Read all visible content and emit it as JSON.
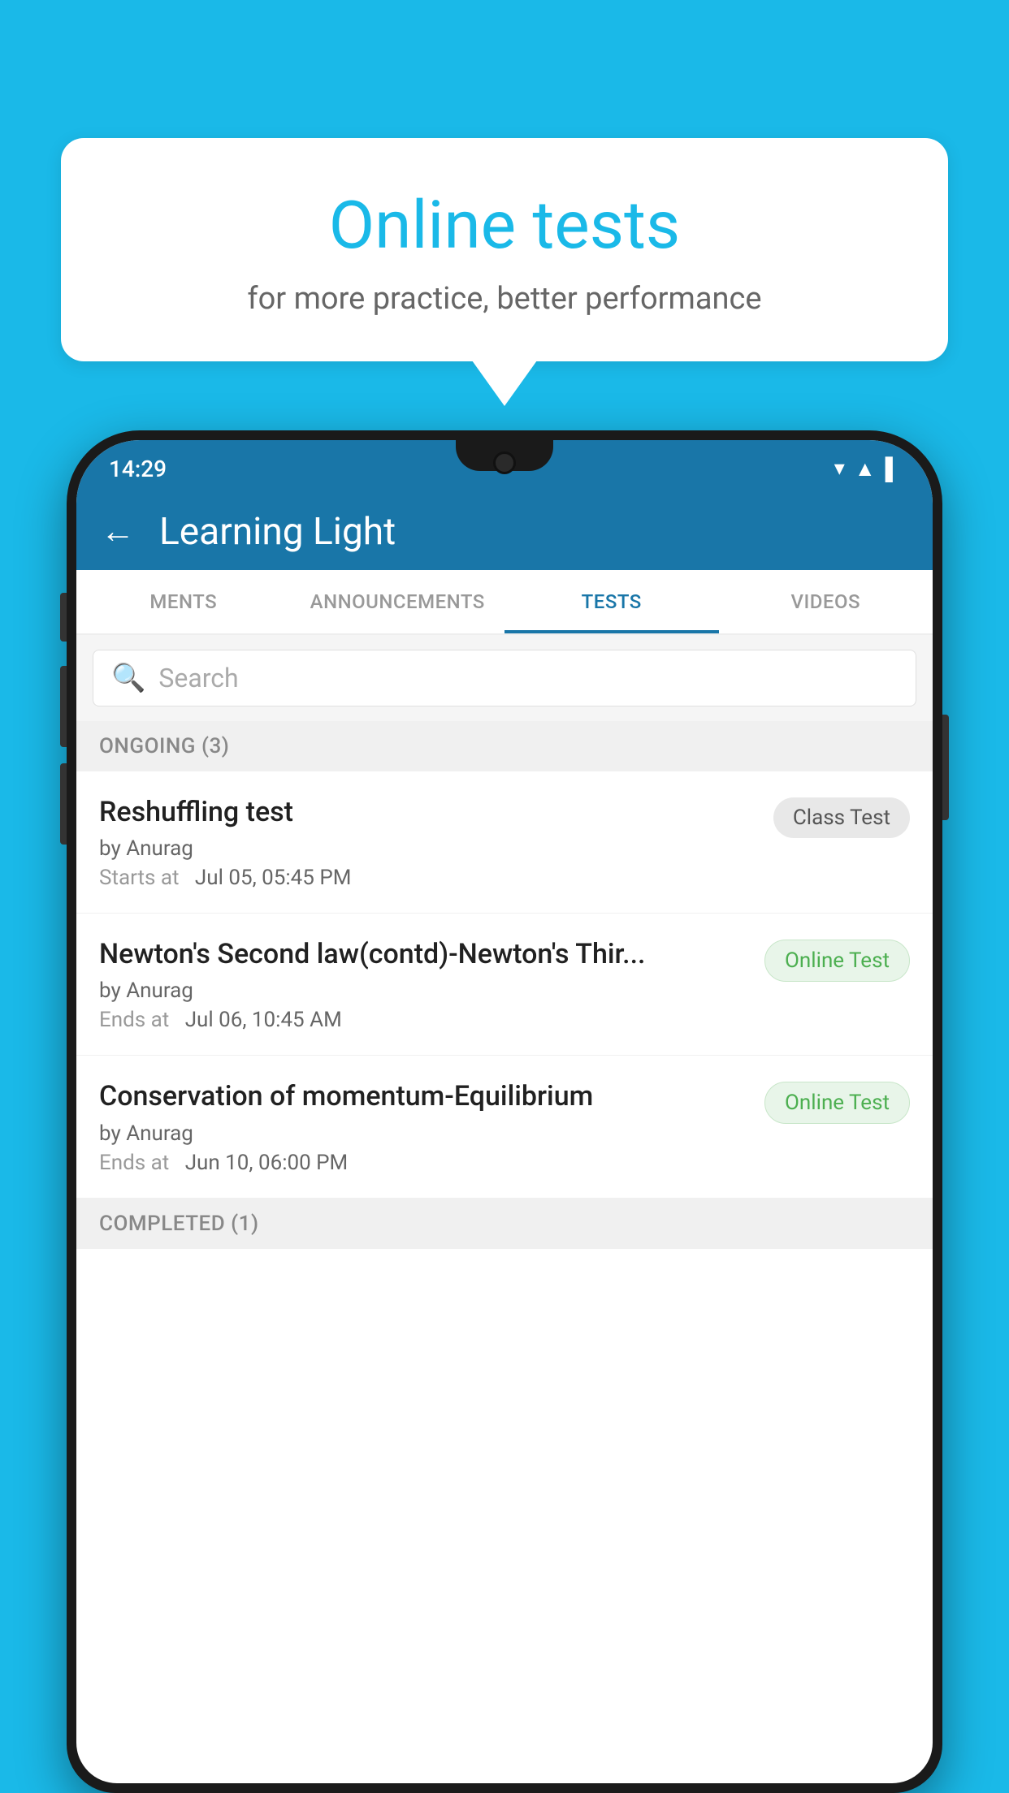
{
  "background_color": "#1ab9e8",
  "speech_bubble": {
    "title": "Online tests",
    "subtitle": "for more practice, better performance"
  },
  "app": {
    "name": "Learning Light",
    "back_label": "←"
  },
  "status_bar": {
    "time": "14:29"
  },
  "tabs": [
    {
      "label": "MENTS",
      "active": false
    },
    {
      "label": "ANNOUNCEMENTS",
      "active": false
    },
    {
      "label": "TESTS",
      "active": true
    },
    {
      "label": "VIDEOS",
      "active": false
    }
  ],
  "search": {
    "placeholder": "Search"
  },
  "sections": [
    {
      "header": "ONGOING (3)",
      "items": [
        {
          "name": "Reshuffling test",
          "author": "by Anurag",
          "time_label": "Starts at",
          "time_value": "Jul 05, 05:45 PM",
          "badge": "Class Test",
          "badge_type": "class"
        },
        {
          "name": "Newton's Second law(contd)-Newton's Thir...",
          "author": "by Anurag",
          "time_label": "Ends at",
          "time_value": "Jul 06, 10:45 AM",
          "badge": "Online Test",
          "badge_type": "online"
        },
        {
          "name": "Conservation of momentum-Equilibrium",
          "author": "by Anurag",
          "time_label": "Ends at",
          "time_value": "Jun 10, 06:00 PM",
          "badge": "Online Test",
          "badge_type": "online"
        }
      ]
    },
    {
      "header": "COMPLETED (1)",
      "items": []
    }
  ]
}
